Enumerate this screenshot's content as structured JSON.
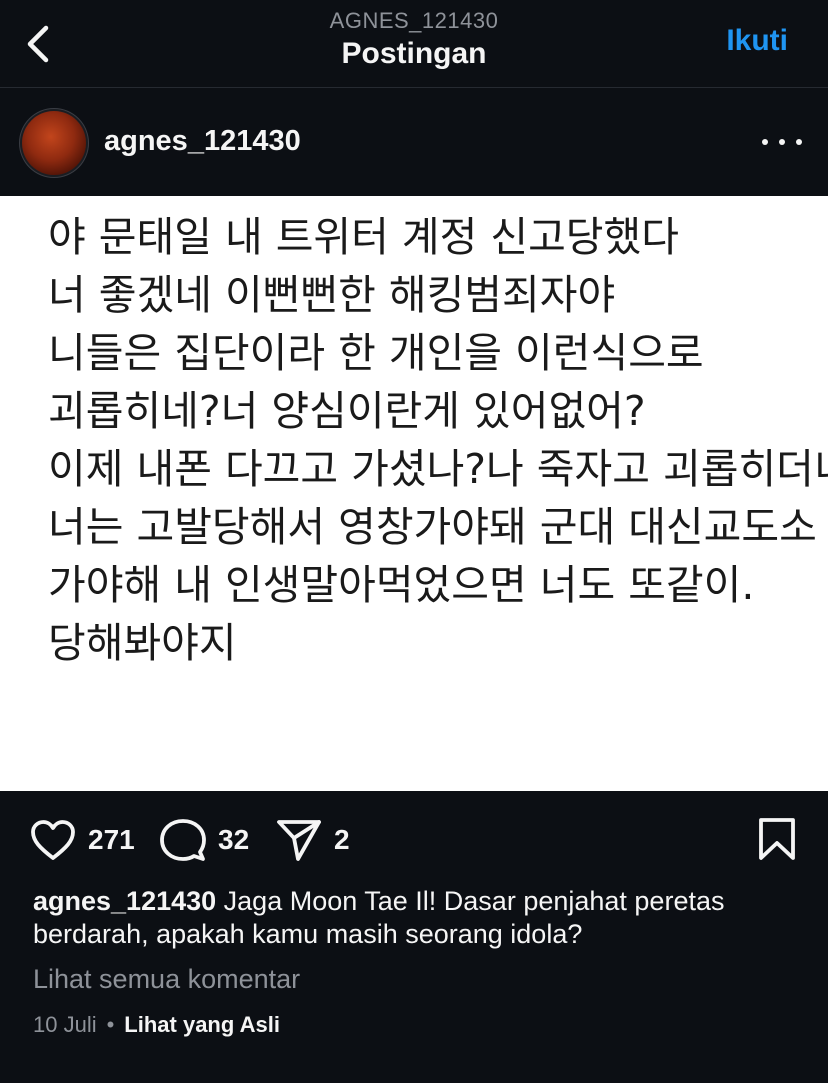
{
  "header": {
    "username": "AGNES_121430",
    "title": "Postingan",
    "follow_label": "Ikuti",
    "back_icon": "chevron-left-icon"
  },
  "post": {
    "username": "agnes_121430",
    "more_icon": "more-horizontal-icon",
    "image_text_lines": [
      "야 문태일 내 트위터 계정 신고당했다",
      "너 좋겠네 이뻔뻔한 해킹범죄자야",
      "니들은 집단이라 한 개인을 이런식으로",
      "괴롭히네?너 양심이란게 있어없어?",
      "이제 내폰 다끄고 가셨나?나 죽자고 괴롭히더니",
      "너는 고발당해서 영창가야돼 군대 대신교도소",
      "가야해 내 인생말아먹었으면 너도 또같이.",
      "당해봐야지"
    ]
  },
  "actions": {
    "likes": "271",
    "comments": "32",
    "shares": "2",
    "like_icon": "heart-icon",
    "comment_icon": "comment-bubble-icon",
    "share_icon": "paper-plane-icon",
    "save_icon": "bookmark-icon"
  },
  "caption": {
    "username": "agnes_121430",
    "text": " Jaga Moon Tae Il! Dasar penjahat peretas berdarah, apakah kamu masih seorang idola?"
  },
  "view_comments": "Lihat semua komentar",
  "meta": {
    "date": "10 Juli",
    "separator": "•",
    "see_original": "Lihat yang Asli"
  },
  "colors": {
    "background": "#0c0f14",
    "accent": "#1f95f2",
    "muted": "#8e9299"
  }
}
